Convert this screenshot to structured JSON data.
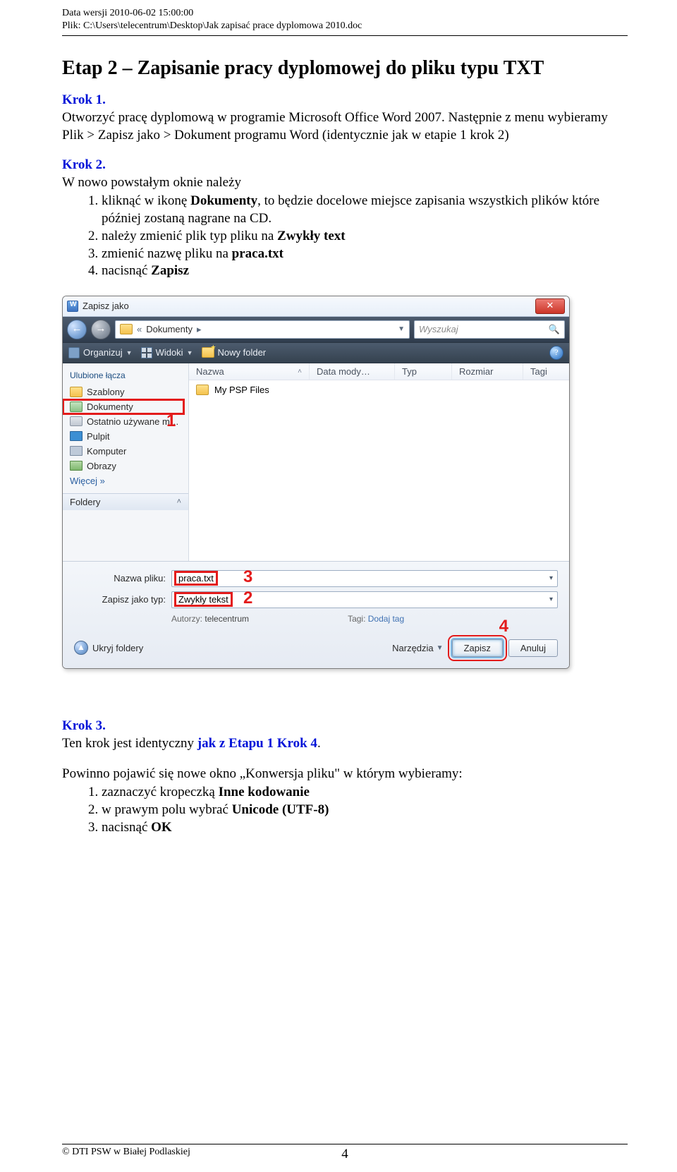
{
  "header": {
    "version_line": "Data wersji 2010-06-02 15:00:00",
    "file_line": "Plik: C:\\Users\\telecentrum\\Desktop\\Jak zapisać prace dyplomowa 2010.doc"
  },
  "title": "Etap 2 – Zapisanie pracy dyplomowej do pliku typu TXT",
  "step1": {
    "heading": "Krok 1.",
    "p1": "Otworzyć pracę dyplomową w programie Microsoft Office Word 2007. Następnie z menu wybieramy",
    "p2": "Plik > Zapisz jako > Dokument programu Word (identycznie jak w etapie 1 krok 2)"
  },
  "step2": {
    "heading": "Krok 2.",
    "intro": "W nowo powstałym oknie należy",
    "items": [
      "kliknąć w ikonę Dokumenty, to będzie docelowe miejsce zapisania wszystkich plików które później zostaną nagrane na CD.",
      "należy zmienić plik typ pliku na Zwykły text",
      "zmienić nazwę pliku na praca.txt",
      "nacisnąć Zapisz"
    ],
    "bold_in": {
      "i0": "Dokumenty",
      "i1": "Zwykły text",
      "i2": "praca.txt",
      "i3": "Zapisz"
    }
  },
  "dialog": {
    "title": "Zapisz jako",
    "breadcrumb": "Dokumenty",
    "search_placeholder": "Wyszukaj",
    "toolbar": {
      "organize": "Organizuj",
      "views": "Widoki",
      "newfolder": "Nowy folder"
    },
    "sidebar": {
      "header": "Ulubione łącza",
      "items": [
        "Szablony",
        "Dokumenty",
        "Ostatnio używane m…",
        "Pulpit",
        "Komputer",
        "Obrazy"
      ],
      "more": "Więcej »",
      "foldery": "Foldery"
    },
    "columns": {
      "name": "Nazwa",
      "date": "Data mody…",
      "type": "Typ",
      "size": "Rozmiar",
      "tags": "Tagi"
    },
    "files": [
      "My PSP Files"
    ],
    "form": {
      "name_label": "Nazwa pliku:",
      "name_value": "praca.txt",
      "type_label": "Zapisz jako typ:",
      "type_value": "Zwykły tekst",
      "authors_label": "Autorzy:",
      "authors_value": "telecentrum",
      "tags_label": "Tagi:",
      "tags_value": "Dodaj tag"
    },
    "actions": {
      "hide": "Ukryj foldery",
      "tools": "Narzędzia",
      "save": "Zapisz",
      "cancel": "Anuluj"
    }
  },
  "callouts": {
    "c1": "1",
    "c2": "2",
    "c3": "3",
    "c4": "4"
  },
  "step3": {
    "heading": "Krok 3.",
    "line1_a": "Ten krok jest identyczny ",
    "line1_b": "jak z Etapu 1 Krok 4",
    "line1_c": ".",
    "intro": "Powinno pojawić się nowe okno „Konwersja pliku\" w którym wybieramy:",
    "items_plain": [
      "zaznaczyć kropeczką ",
      "w prawym polu wybrać ",
      "nacisnąć "
    ],
    "items_bold": [
      "Inne kodowanie",
      "Unicode (UTF-8)",
      "OK"
    ]
  },
  "footer": {
    "copyright": "© DTI PSW w Białej Podlaskiej",
    "page": "4"
  }
}
